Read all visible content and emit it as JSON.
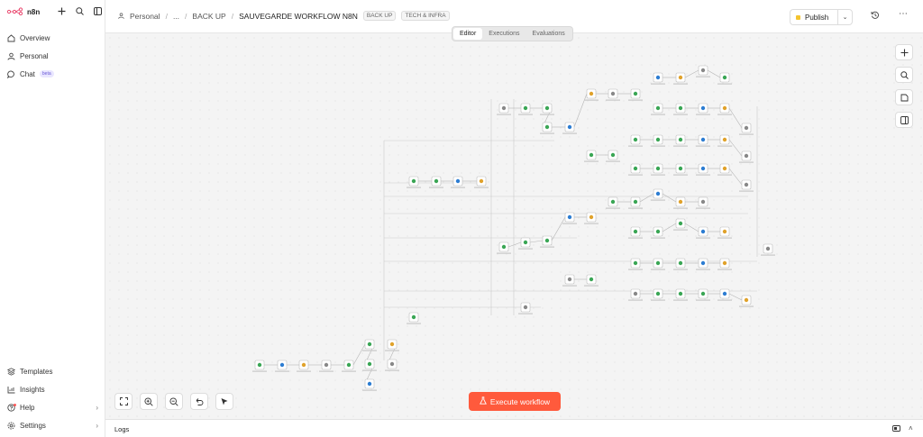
{
  "app": {
    "brand": "n8n"
  },
  "sidebar": {
    "nav": [
      {
        "label": "Overview",
        "icon": "home-icon"
      },
      {
        "label": "Personal",
        "icon": "user-icon"
      },
      {
        "label": "Chat",
        "icon": "chat-icon",
        "badge": "beta"
      }
    ],
    "bottom": [
      {
        "label": "Templates",
        "icon": "templates-icon"
      },
      {
        "label": "Insights",
        "icon": "insights-icon"
      },
      {
        "label": "Help",
        "icon": "help-icon"
      },
      {
        "label": "Settings",
        "icon": "settings-icon"
      }
    ]
  },
  "header": {
    "breadcrumb_root": "Personal",
    "breadcrumb_ellipsis": "...",
    "breadcrumb_folder": "BACK UP",
    "workflow_title": "SAUVEGARDE WORKFLOW N8N",
    "tags": [
      "BACK UP",
      "TECH & INFRA"
    ],
    "publish_label": "Publish",
    "accent_color": "#ff5a3c",
    "publish_dot_color": "#f4c430"
  },
  "tabs": [
    {
      "label": "Editor",
      "active": true
    },
    {
      "label": "Executions",
      "active": false
    },
    {
      "label": "Evaluations",
      "active": false
    }
  ],
  "canvas": {
    "execute_label": "Execute workflow"
  },
  "logs": {
    "label": "Logs"
  }
}
